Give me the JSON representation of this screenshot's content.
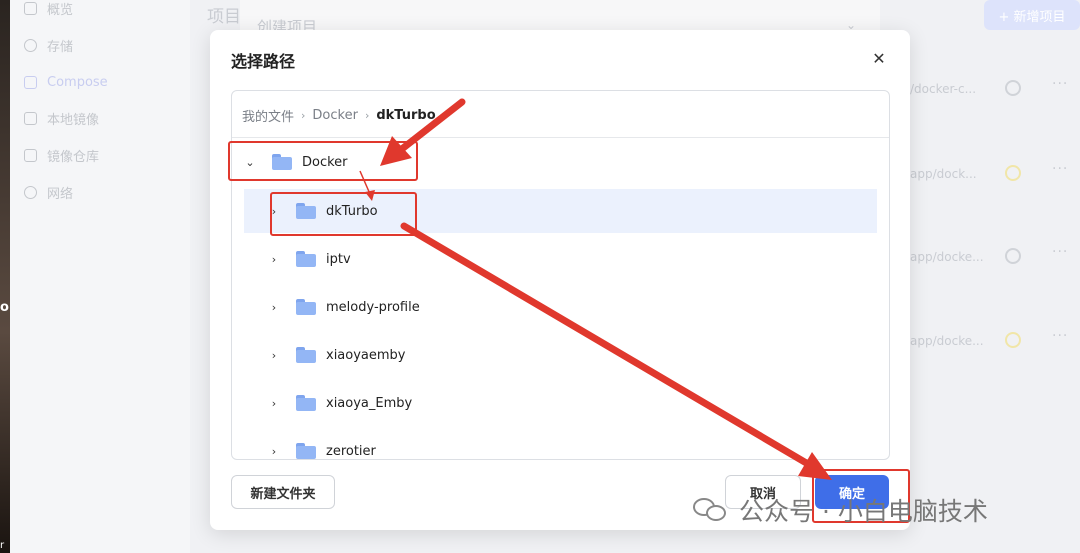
{
  "background": {
    "sidebar_items": [
      {
        "label": "概览",
        "icon": "grid-icon"
      },
      {
        "label": "存储",
        "icon": "cloud-icon"
      },
      {
        "label": "Compose",
        "icon": "layers-icon",
        "active": true
      },
      {
        "label": "本地镜像",
        "icon": "image-icon"
      },
      {
        "label": "镜像仓库",
        "icon": "repo-icon"
      },
      {
        "label": "网络",
        "icon": "globe-icon"
      }
    ],
    "page_title": "项目",
    "panel_title": "创建项目",
    "new_project_button": "+ 新增项目",
    "rows": [
      {
        "path": "/docker-c..."
      },
      {
        "path": "app/dock..."
      },
      {
        "path": "app/docke..."
      },
      {
        "path": "app/docke..."
      }
    ],
    "edge_text": "o",
    "edge_text2": "r"
  },
  "dialog": {
    "title": "选择路径",
    "close_icon": "close-icon",
    "breadcrumb": [
      "我的文件",
      "Docker",
      "dkTurbo"
    ],
    "tree": [
      {
        "label": "Docker",
        "expanded": true,
        "level": 0
      },
      {
        "label": "dkTurbo",
        "expanded": false,
        "level": 1,
        "selected": true
      },
      {
        "label": "iptv",
        "expanded": false,
        "level": 1
      },
      {
        "label": "melody-profile",
        "expanded": false,
        "level": 1
      },
      {
        "label": "xiaoyaemby",
        "expanded": false,
        "level": 1
      },
      {
        "label": "xiaoya_Emby",
        "expanded": false,
        "level": 1
      },
      {
        "label": "zerotier",
        "expanded": false,
        "level": 1
      }
    ],
    "buttons": {
      "new_folder": "新建文件夹",
      "cancel": "取消",
      "confirm": "确定"
    }
  },
  "watermark": {
    "text": "公众号 · 小白电脑技术"
  },
  "colors": {
    "accent": "#3f6ee8",
    "selected_row": "#ebf1fd",
    "annotation_red": "#e0382d",
    "folder": "#93b6f5"
  }
}
